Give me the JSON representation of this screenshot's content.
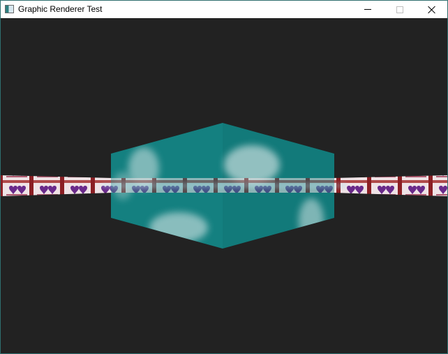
{
  "window": {
    "title": "Graphic Renderer Test",
    "icon": "app-window-icon"
  },
  "caption_buttons": {
    "minimize_icon": "minimize-icon",
    "maximize_icon": "maximize-icon",
    "close_icon": "close-icon"
  },
  "scene": {
    "background_color": "#222222",
    "cube_color": "#148080",
    "cube_highlight_color": "#d8e6e6",
    "strip_color": "#efe3e6",
    "heart_color": "#6a2a8a",
    "strip_frame_color": "#8a1f24"
  }
}
